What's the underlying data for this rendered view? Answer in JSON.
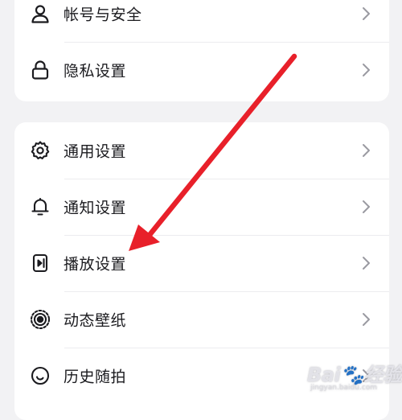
{
  "settings": {
    "group1": [
      {
        "label": "帐号与安全",
        "icon": "user-icon"
      },
      {
        "label": "隐私设置",
        "icon": "lock-icon"
      }
    ],
    "group2": [
      {
        "label": "通用设置",
        "icon": "gear-icon"
      },
      {
        "label": "通知设置",
        "icon": "bell-icon"
      },
      {
        "label": "播放设置",
        "icon": "playback-icon"
      },
      {
        "label": "动态壁纸",
        "icon": "live-wallpaper-icon"
      },
      {
        "label": "历史随拍",
        "icon": "history-snap-icon"
      }
    ]
  },
  "annotation": {
    "arrow_color": "#e8202a",
    "target": "播放设置"
  },
  "watermark": {
    "brand": "Bai",
    "brand_suffix": "经验",
    "url": "jingyan.baidu.com"
  }
}
